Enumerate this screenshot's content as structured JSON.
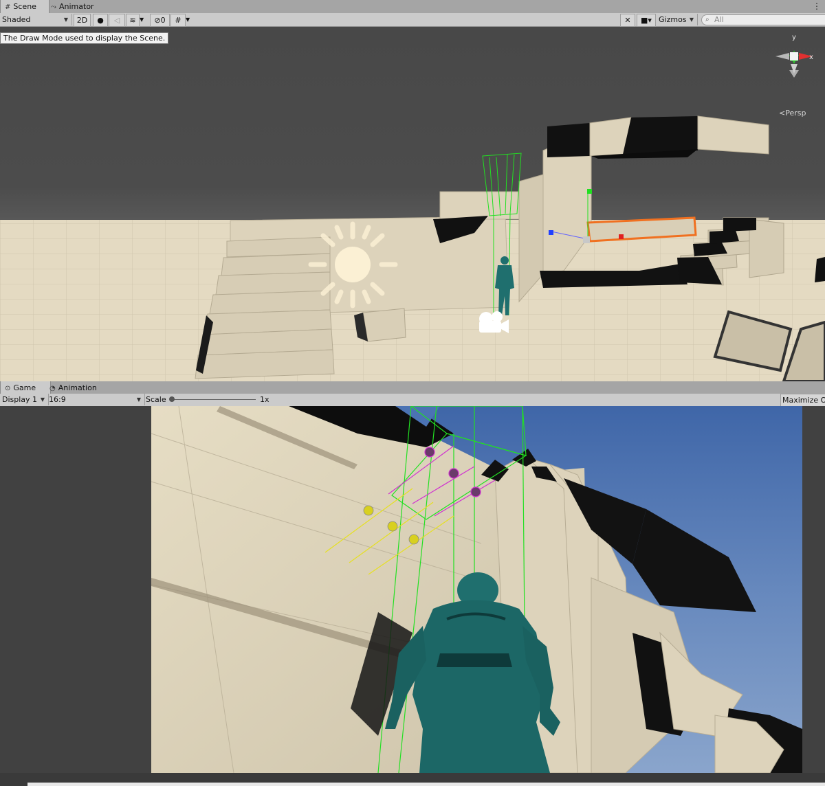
{
  "scene_tabs": [
    {
      "label": "Scene",
      "icon": "grid-icon"
    },
    {
      "label": "Animator",
      "icon": "animator-icon"
    }
  ],
  "scene_toolbar": {
    "draw_mode": "Shaded",
    "mode_2d": "2D",
    "hidden_count": "0",
    "gizmos": "Gizmos",
    "search_placeholder": "All"
  },
  "tooltip": "The Draw Mode used to display the Scene.",
  "orientation_gizmo": {
    "y": "y",
    "x": "x",
    "projection": "Persp"
  },
  "game_tabs": [
    {
      "label": "Game",
      "icon": "gamepad-icon"
    },
    {
      "label": "Animation",
      "icon": "clock-icon"
    }
  ],
  "game_toolbar": {
    "display": "Display 1",
    "aspect": "16:9",
    "scale_label": "Scale",
    "scale_value": "1x",
    "scale_level": 0.0,
    "maximize": "Maximize On Play"
  },
  "colors": {
    "ground": "#e3d9c1",
    "block": "#ddd3bb",
    "block_dark": "#c2b8a0",
    "sky_game": "#6b8cc0",
    "character": "#1f6f6e",
    "gizmo_green": "#22e022",
    "gizmo_yellow": "#e6e020",
    "gizmo_magenta": "#d030d0",
    "selection_orange": "#f07020"
  }
}
